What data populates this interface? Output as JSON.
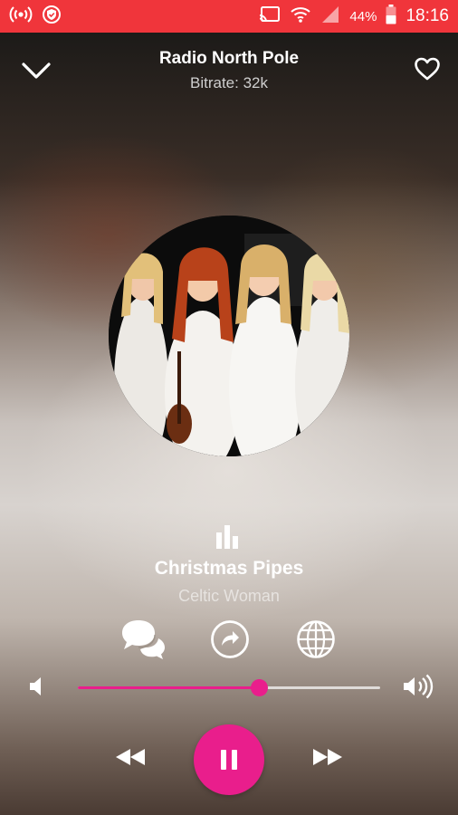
{
  "status_bar": {
    "battery": "44%",
    "time": "18:16",
    "icons": [
      "broadcast-icon",
      "shield-icon",
      "cast-icon",
      "wifi-icon",
      "signal-icon",
      "battery-icon"
    ]
  },
  "header": {
    "station": "Radio North Pole",
    "bitrate": "Bitrate: 32k",
    "icons": [
      "chevron-down-icon",
      "heart-outline-icon"
    ]
  },
  "now_playing": {
    "track": "Christmas Pipes",
    "artist": "Celtic Woman"
  },
  "actions": {
    "icons": [
      "chat-icon",
      "share-icon",
      "globe-icon"
    ]
  },
  "volume": {
    "level": 0.6,
    "icons": [
      "volume-low-icon",
      "volume-high-icon"
    ]
  },
  "controls": {
    "icons": [
      "rewind-icon",
      "pause-icon",
      "fast-forward-icon"
    ]
  },
  "colors": {
    "status_bar": "#f0353b",
    "accent": "#e91e8c"
  }
}
